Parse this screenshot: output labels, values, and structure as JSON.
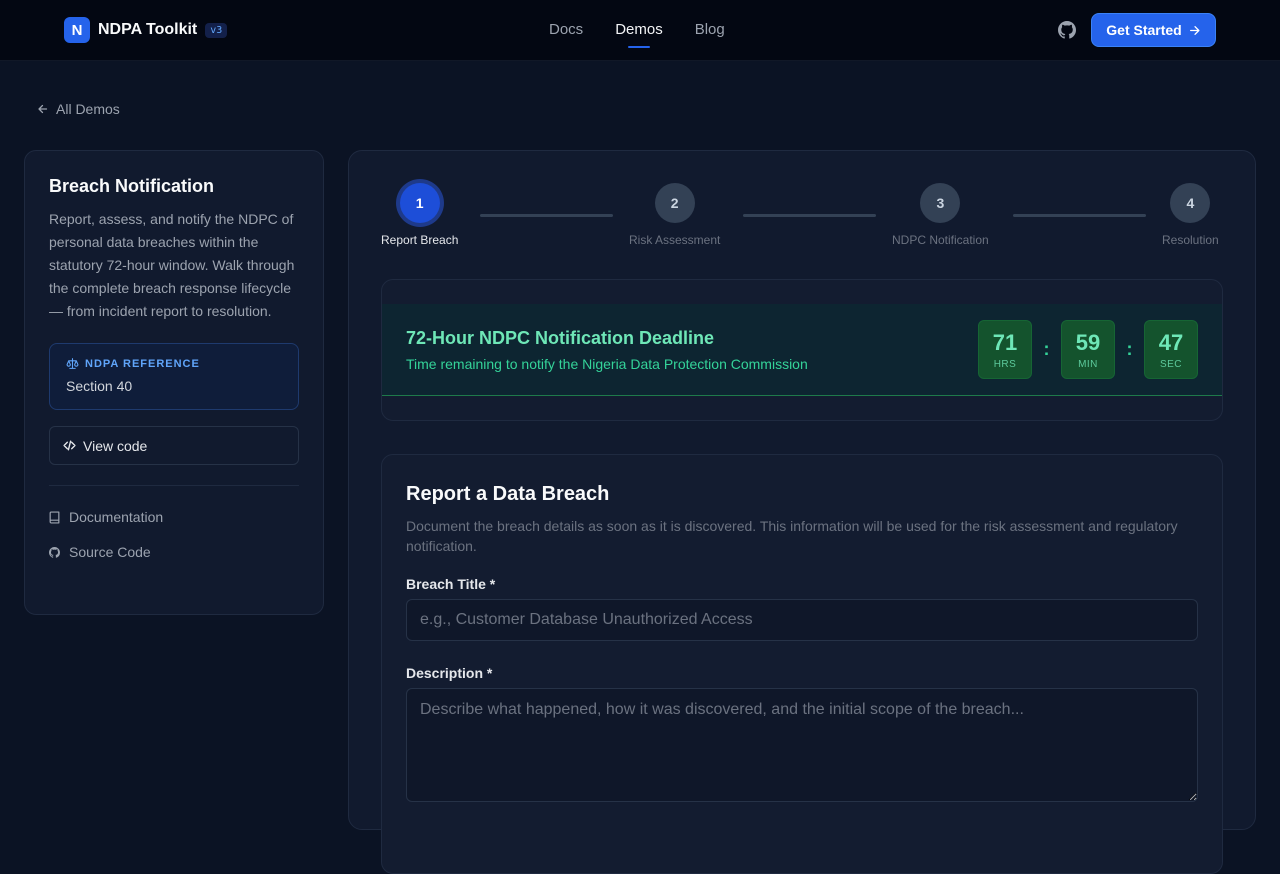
{
  "header": {
    "brand_initial": "N",
    "brand_name": "NDPA Toolkit",
    "version": "v3",
    "nav": [
      {
        "label": "Docs",
        "active": false
      },
      {
        "label": "Demos",
        "active": true
      },
      {
        "label": "Blog",
        "active": false
      }
    ],
    "github_icon": "github-icon",
    "cta_label": "Get Started"
  },
  "back_link": "All Demos",
  "sidebar": {
    "title": "Breach Notification",
    "description": "Report, assess, and notify the NDPC of personal data breaches within the statutory 72-hour window. Walk through the complete breach response lifecycle — from incident report to resolution.",
    "reference_label": "NDPA REFERENCE",
    "reference_value": "Section 40",
    "view_code_label": "View code",
    "links": [
      {
        "label": "Documentation",
        "icon": "book-icon"
      },
      {
        "label": "Source Code",
        "icon": "github-icon"
      }
    ]
  },
  "stepper": {
    "steps": [
      {
        "number": "1",
        "label": "Report Breach",
        "active": true
      },
      {
        "number": "2",
        "label": "Risk Assessment",
        "active": false
      },
      {
        "number": "3",
        "label": "NDPC Notification",
        "active": false
      },
      {
        "number": "4",
        "label": "Resolution",
        "active": false
      }
    ]
  },
  "deadline": {
    "title": "72-Hour NDPC Notification Deadline",
    "subtitle": "Time remaining to notify the Nigeria Data Protection Commission",
    "hours": "71",
    "hours_unit": "HRS",
    "minutes": "59",
    "minutes_unit": "MIN",
    "seconds": "47",
    "seconds_unit": "SEC",
    "separator": ":"
  },
  "form": {
    "title": "Report a Data Breach",
    "description": "Document the breach details as soon as it is discovered. This information will be used for the risk assessment and regulatory notification.",
    "breach_title_label": "Breach Title *",
    "breach_title_placeholder": "e.g., Customer Database Unauthorized Access",
    "breach_title_value": "",
    "description_label": "Description *",
    "description_placeholder": "Describe what happened, how it was discovered, and the initial scope of the breach...",
    "description_value": ""
  },
  "colors": {
    "accent": "#2563eb",
    "success": "#34d399",
    "background": "#0b1324"
  }
}
